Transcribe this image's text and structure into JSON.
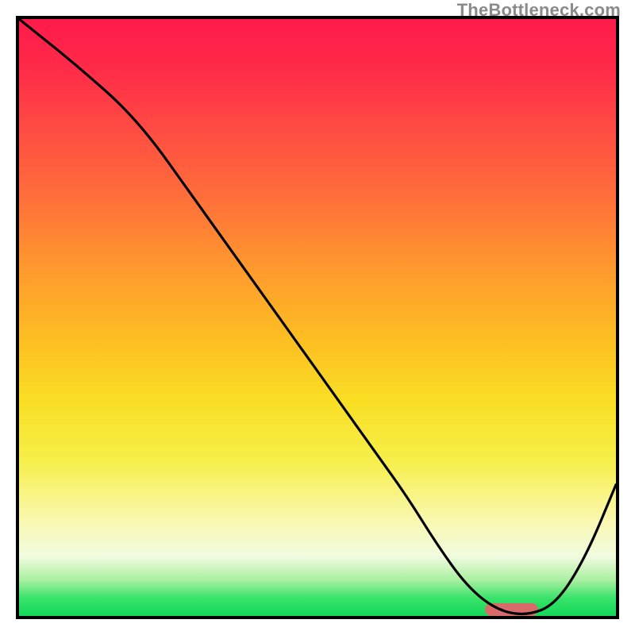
{
  "watermark": "TheBottleneck.com",
  "chart_data": {
    "type": "line",
    "title": "",
    "xlabel": "",
    "ylabel": "",
    "xlim": [
      0,
      100
    ],
    "ylim": [
      0,
      100
    ],
    "grid": false,
    "x": [
      0,
      10,
      20,
      30,
      40,
      50,
      60,
      65,
      70,
      75,
      80,
      85,
      90,
      95,
      100
    ],
    "values": [
      100,
      92,
      83,
      69,
      55,
      41,
      27,
      20,
      12,
      5,
      1,
      0,
      2,
      10,
      22
    ],
    "optimal_range_x": [
      78,
      87
    ],
    "background_gradient_stops": [
      {
        "pos": 0.0,
        "color": "#ff1a4a"
      },
      {
        "pos": 0.3,
        "color": "#ff6f3a"
      },
      {
        "pos": 0.54,
        "color": "#fdbf22"
      },
      {
        "pos": 0.74,
        "color": "#f6ef4a"
      },
      {
        "pos": 0.9,
        "color": "#f1fbe0"
      },
      {
        "pos": 1.0,
        "color": "#14d85a"
      }
    ]
  }
}
